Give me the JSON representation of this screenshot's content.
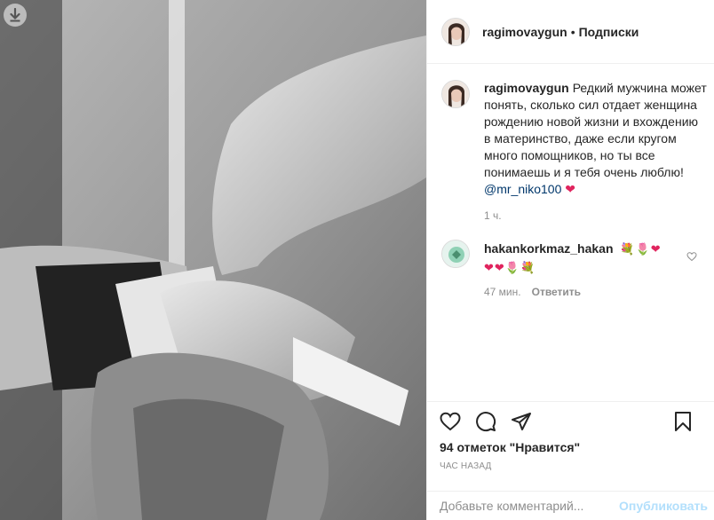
{
  "post": {
    "username": "ragimovaygun",
    "dot": "•",
    "follow_label": "Подписки"
  },
  "caption": {
    "username": "ragimovaygun",
    "text": "Редкий мужчина может понять, сколько сил отдает женщина рождению новой жизни и вхождению в материнство, даже если кругом много помощников, но ты все понимаешь и я тебя очень люблю! ",
    "mention": "@mr_niko100",
    "emoji": "❤",
    "time": "1 ч."
  },
  "comment": {
    "username": "hakankorkmaz_hakan",
    "emojis_line1": [
      "💐",
      "🌷",
      "❤"
    ],
    "emojis_line2": [
      "❤",
      "❤",
      "🌷",
      "💐"
    ],
    "time": "47 мин.",
    "reply_label": "Ответить"
  },
  "likes_text": "94 отметок \"Нравится\"",
  "posted_ago": "час назад",
  "add_comment": {
    "placeholder": "Добавьте комментарий...",
    "post_label": "Опубликовать"
  },
  "icons": {
    "download": "download-icon",
    "like": "heart-icon",
    "comment": "comment-icon",
    "share": "share-icon",
    "save": "bookmark-icon",
    "comment_like": "small-heart-icon"
  },
  "colors": {
    "mention": "#00376b",
    "post_button": "#b2dffc",
    "muted": "#8e8e8e"
  }
}
